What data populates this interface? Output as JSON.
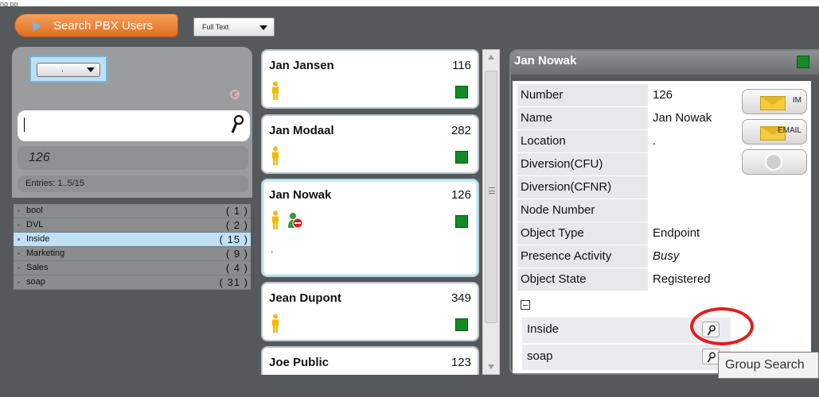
{
  "top_cut_text": "ng pp",
  "toolbar": {
    "search_tab_label": "Search PBX Users",
    "mode_select_value": "Full Text"
  },
  "filter": {
    "select_value": ".",
    "search_value": "",
    "result_value": "126",
    "entries_label": "Entries: 1..5/15"
  },
  "groups": [
    {
      "name": "bool",
      "count": "( 1 )"
    },
    {
      "name": "DVL",
      "count": "( 2 )"
    },
    {
      "name": "Inside",
      "count": "( 15 )"
    },
    {
      "name": "Marketing",
      "count": "( 9 )"
    },
    {
      "name": "Sales",
      "count": "( 4 )"
    },
    {
      "name": "soap",
      "count": "( 31 )"
    }
  ],
  "cards": [
    {
      "name": "Jan Jansen",
      "number": "116"
    },
    {
      "name": "Jan Modaal",
      "number": "282"
    },
    {
      "name": "Jan Nowak",
      "number": "126",
      "extra": "."
    },
    {
      "name": "Jean Dupont",
      "number": "349"
    },
    {
      "name": "Joe Public",
      "number": "123"
    }
  ],
  "detail": {
    "title": "Jan Nowak",
    "rows": [
      {
        "key": "Number",
        "value": "126"
      },
      {
        "key": "Name",
        "value": "Jan Nowak"
      },
      {
        "key": "Location",
        "value": "."
      },
      {
        "key": "Diversion(CFU)",
        "value": ""
      },
      {
        "key": "Diversion(CFNR)",
        "value": ""
      },
      {
        "key": "Node Number",
        "value": ""
      },
      {
        "key": "Object Type",
        "value": "Endpoint"
      },
      {
        "key": "Presence Activity",
        "value": "Busy"
      },
      {
        "key": "Object State",
        "value": "Registered"
      }
    ],
    "groups": [
      "Inside",
      "soap"
    ],
    "buttons": {
      "im": "IM",
      "email": "EMAIL"
    },
    "tooltip": "Group Search"
  },
  "colors": {
    "accent_orange": "#e8772b",
    "status_green": "#138a24",
    "highlight_red": "#e31d1d"
  }
}
